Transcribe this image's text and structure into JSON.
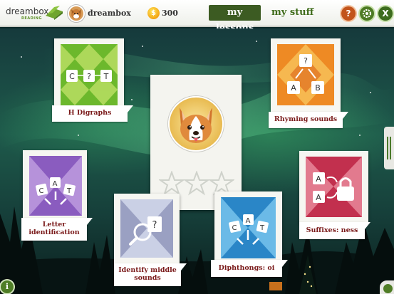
{
  "header": {
    "logo": {
      "word": "dreambox",
      "sub": "READING"
    },
    "user": {
      "name": "dreambox",
      "avatar": "dog-avatar-icon"
    },
    "coins": {
      "icon": "$",
      "count": "300"
    },
    "tabs": {
      "my_lessons": "my lessons",
      "my_stuff": "my stuff"
    },
    "buttons": {
      "help": "?",
      "settings": "gear-icon",
      "exit": "X"
    }
  },
  "featured": {
    "mascot": "corgi",
    "stars": 3,
    "stars_earned": 0
  },
  "lessons": [
    {
      "title": "H Digraphs",
      "tiles": [
        "C",
        "?",
        "T"
      ],
      "colors": [
        "#4f9a1a",
        "#bfe060"
      ]
    },
    {
      "title": "Rhyming sounds",
      "tiles": [
        "?",
        "A",
        "B"
      ],
      "colors": [
        "#e0781e",
        "#f7c35b"
      ]
    },
    {
      "title": "Letter identification",
      "tiles": [
        "C",
        "A",
        "T"
      ],
      "colors": [
        "#7b4fa8",
        "#c9a9e6"
      ]
    },
    {
      "title": "Identify middle sounds",
      "tiles": [
        "?"
      ],
      "colors": [
        "#7f86a9",
        "#d7dcee"
      ]
    },
    {
      "title": "Diphthongs: oi",
      "tiles": [
        "C",
        "A",
        "T"
      ],
      "colors": [
        "#1f6ca6",
        "#74c4ef"
      ]
    },
    {
      "title": "Suffixes: ness",
      "tiles": [
        "A",
        "A"
      ],
      "colors": [
        "#b5213f",
        "#f195a7"
      ]
    }
  ],
  "footer": {
    "info": "i"
  }
}
